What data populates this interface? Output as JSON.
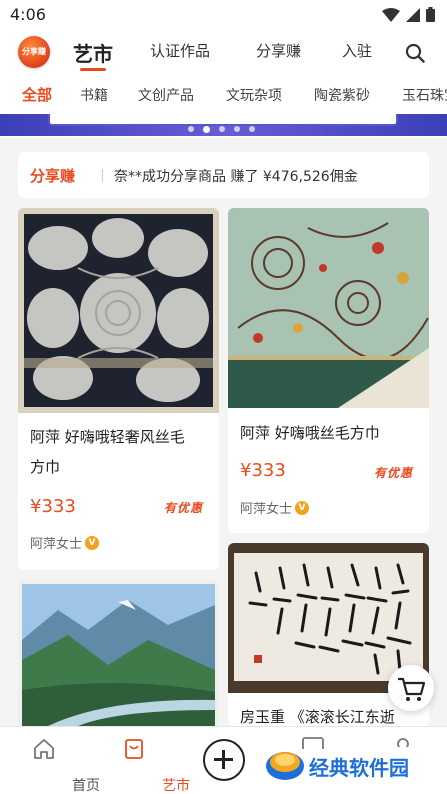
{
  "status_bar": {
    "time": "4:06"
  },
  "app": {
    "logo_text": "分享赚"
  },
  "top_nav": {
    "tabs": [
      {
        "label": "艺市"
      },
      {
        "label": "认证作品"
      },
      {
        "label": "分享赚"
      },
      {
        "label": "入驻"
      }
    ]
  },
  "categories": [
    "全部",
    "书籍",
    "文创产品",
    "文玩杂项",
    "陶瓷紫砂",
    "玉石珠宝"
  ],
  "share_bar": {
    "title": "分享赚",
    "message": "奈**成功分享商品 赚了 ¥476,526佣金"
  },
  "products": [
    {
      "title_line1": "阿萍 好嗨哦轻奢风丝毛",
      "title_line2": "方巾",
      "price": "¥333",
      "badge": "有优惠",
      "seller": "阿萍女士"
    },
    {
      "title_line1": "阿萍 好嗨哦丝毛方巾",
      "price": "¥333",
      "badge": "有优惠",
      "seller": "阿萍女士"
    },
    {
      "title_line1": "房玉重 《滚滚长江东逝"
    }
  ],
  "verified_mark": "V",
  "bottom_nav": {
    "items": [
      {
        "label": "首页"
      },
      {
        "label": "艺市"
      }
    ]
  },
  "watermark": {
    "text": "经典软件园"
  },
  "colors": {
    "accent": "#e84c1e",
    "verified": "#f0a21b",
    "watermark_blue": "#1e6fd9"
  }
}
